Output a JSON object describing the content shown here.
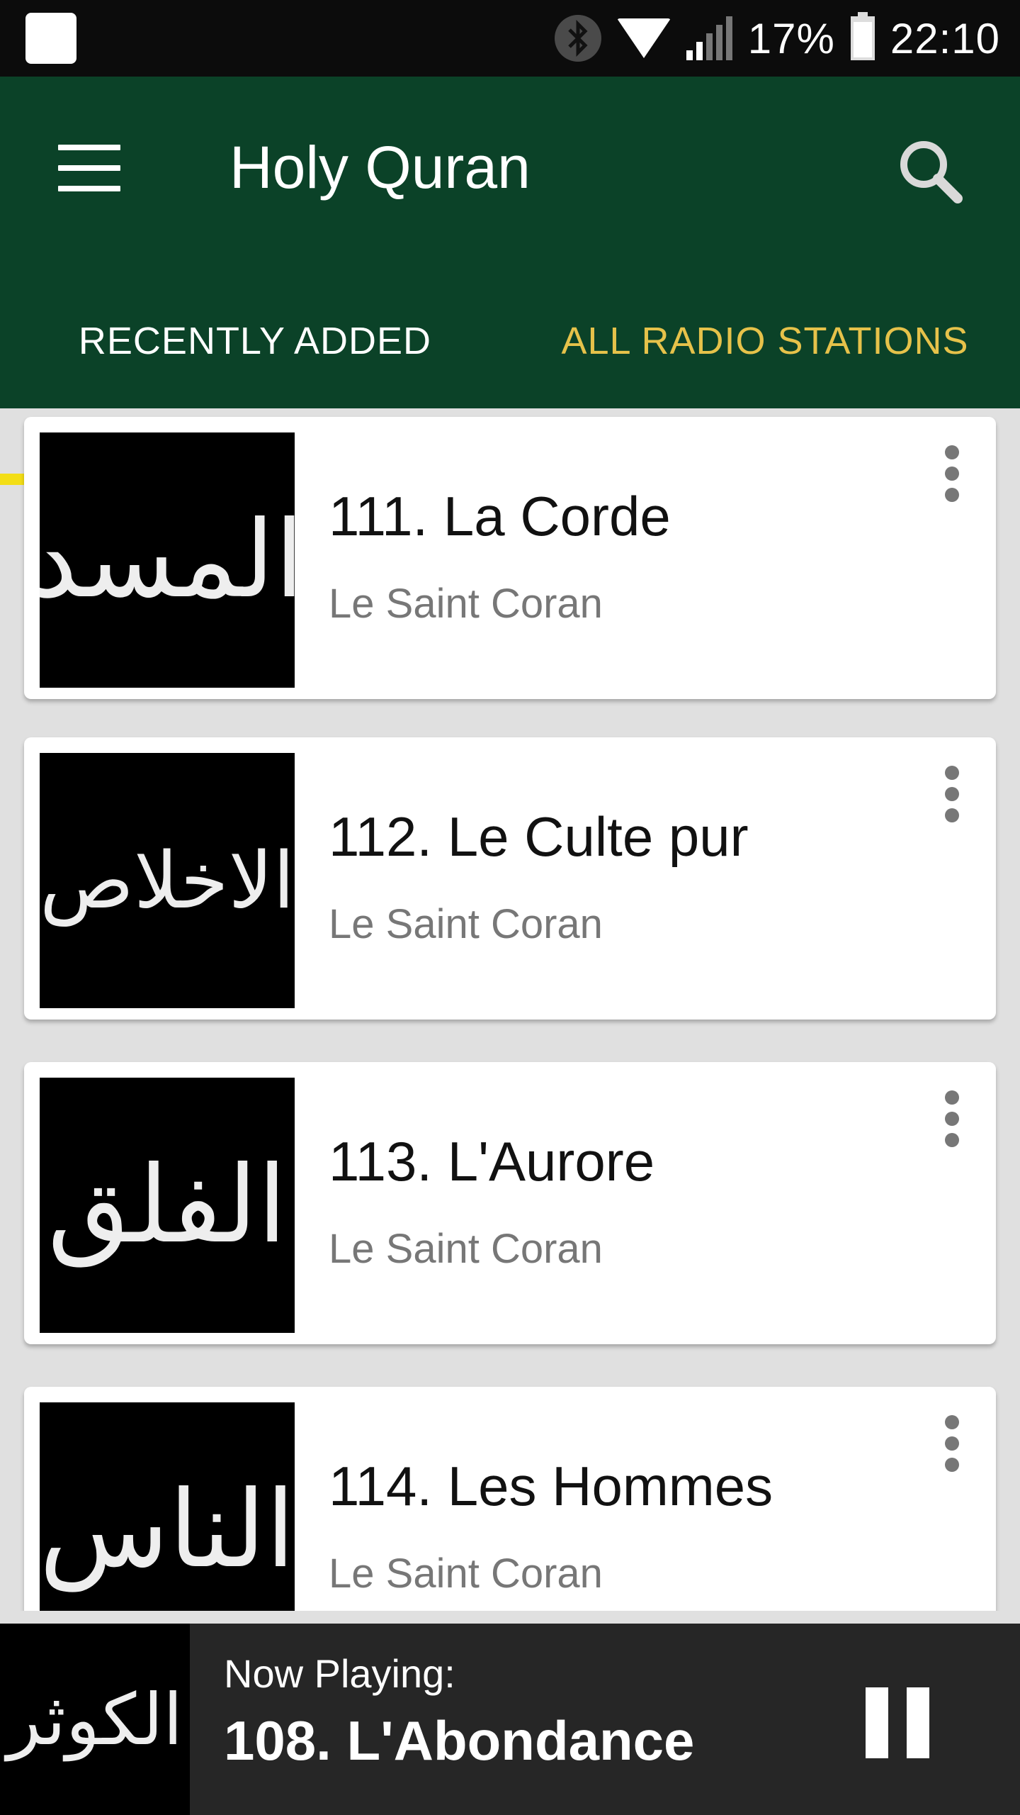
{
  "status_bar": {
    "battery": "17%",
    "time": "22:10",
    "icons": [
      "notification-icon",
      "bluetooth-icon",
      "wifi-icon",
      "signal-icon",
      "battery-icon"
    ]
  },
  "app_bar": {
    "title": "Holy Quran",
    "menu_icon": "menu-icon",
    "search_icon": "search-icon",
    "background": "#0b4228"
  },
  "tabs": [
    {
      "label": "RECENTLY ADDED",
      "active": true
    },
    {
      "label": "ALL RADIO STATIONS",
      "active": false
    }
  ],
  "accent": "#f3de16",
  "items": [
    {
      "arabic": "المسد",
      "title": "111. La Corde",
      "subtitle": "Le Saint Coran"
    },
    {
      "arabic": "الاخلاص",
      "title": "112. Le Culte pur",
      "subtitle": "Le Saint Coran"
    },
    {
      "arabic": "الفلق",
      "title": "113. L'Aurore",
      "subtitle": "Le Saint Coran"
    },
    {
      "arabic": "الناس",
      "title": "114. Les Hommes",
      "subtitle": "Le Saint Coran"
    }
  ],
  "player": {
    "arabic": "الكوثر",
    "label": "Now Playing:",
    "title": "108. L'Abondance",
    "control": "pause-icon"
  }
}
